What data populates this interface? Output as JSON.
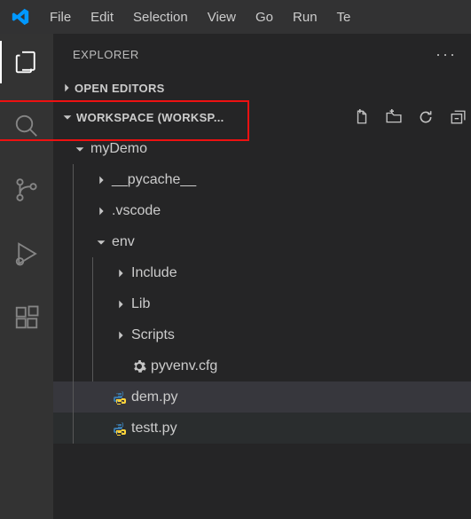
{
  "menu": {
    "items": [
      "File",
      "Edit",
      "Selection",
      "View",
      "Go",
      "Run",
      "Te"
    ]
  },
  "sidebar": {
    "title": "EXPLORER",
    "sections": {
      "openEditors": "OPEN EDITORS",
      "workspace": "WORKSPACE (WORKSP..."
    }
  },
  "tree": {
    "myDemo": "myDemo",
    "pycache": "__pycache__",
    "vscode": ".vscode",
    "env": "env",
    "include": "Include",
    "lib": "Lib",
    "scripts": "Scripts",
    "pyvenv": "pyvenv.cfg",
    "dem": "dem.py",
    "testt": "testt.py"
  },
  "colors": {
    "python": "#3b78a8",
    "gear": "#c5c5c5"
  }
}
